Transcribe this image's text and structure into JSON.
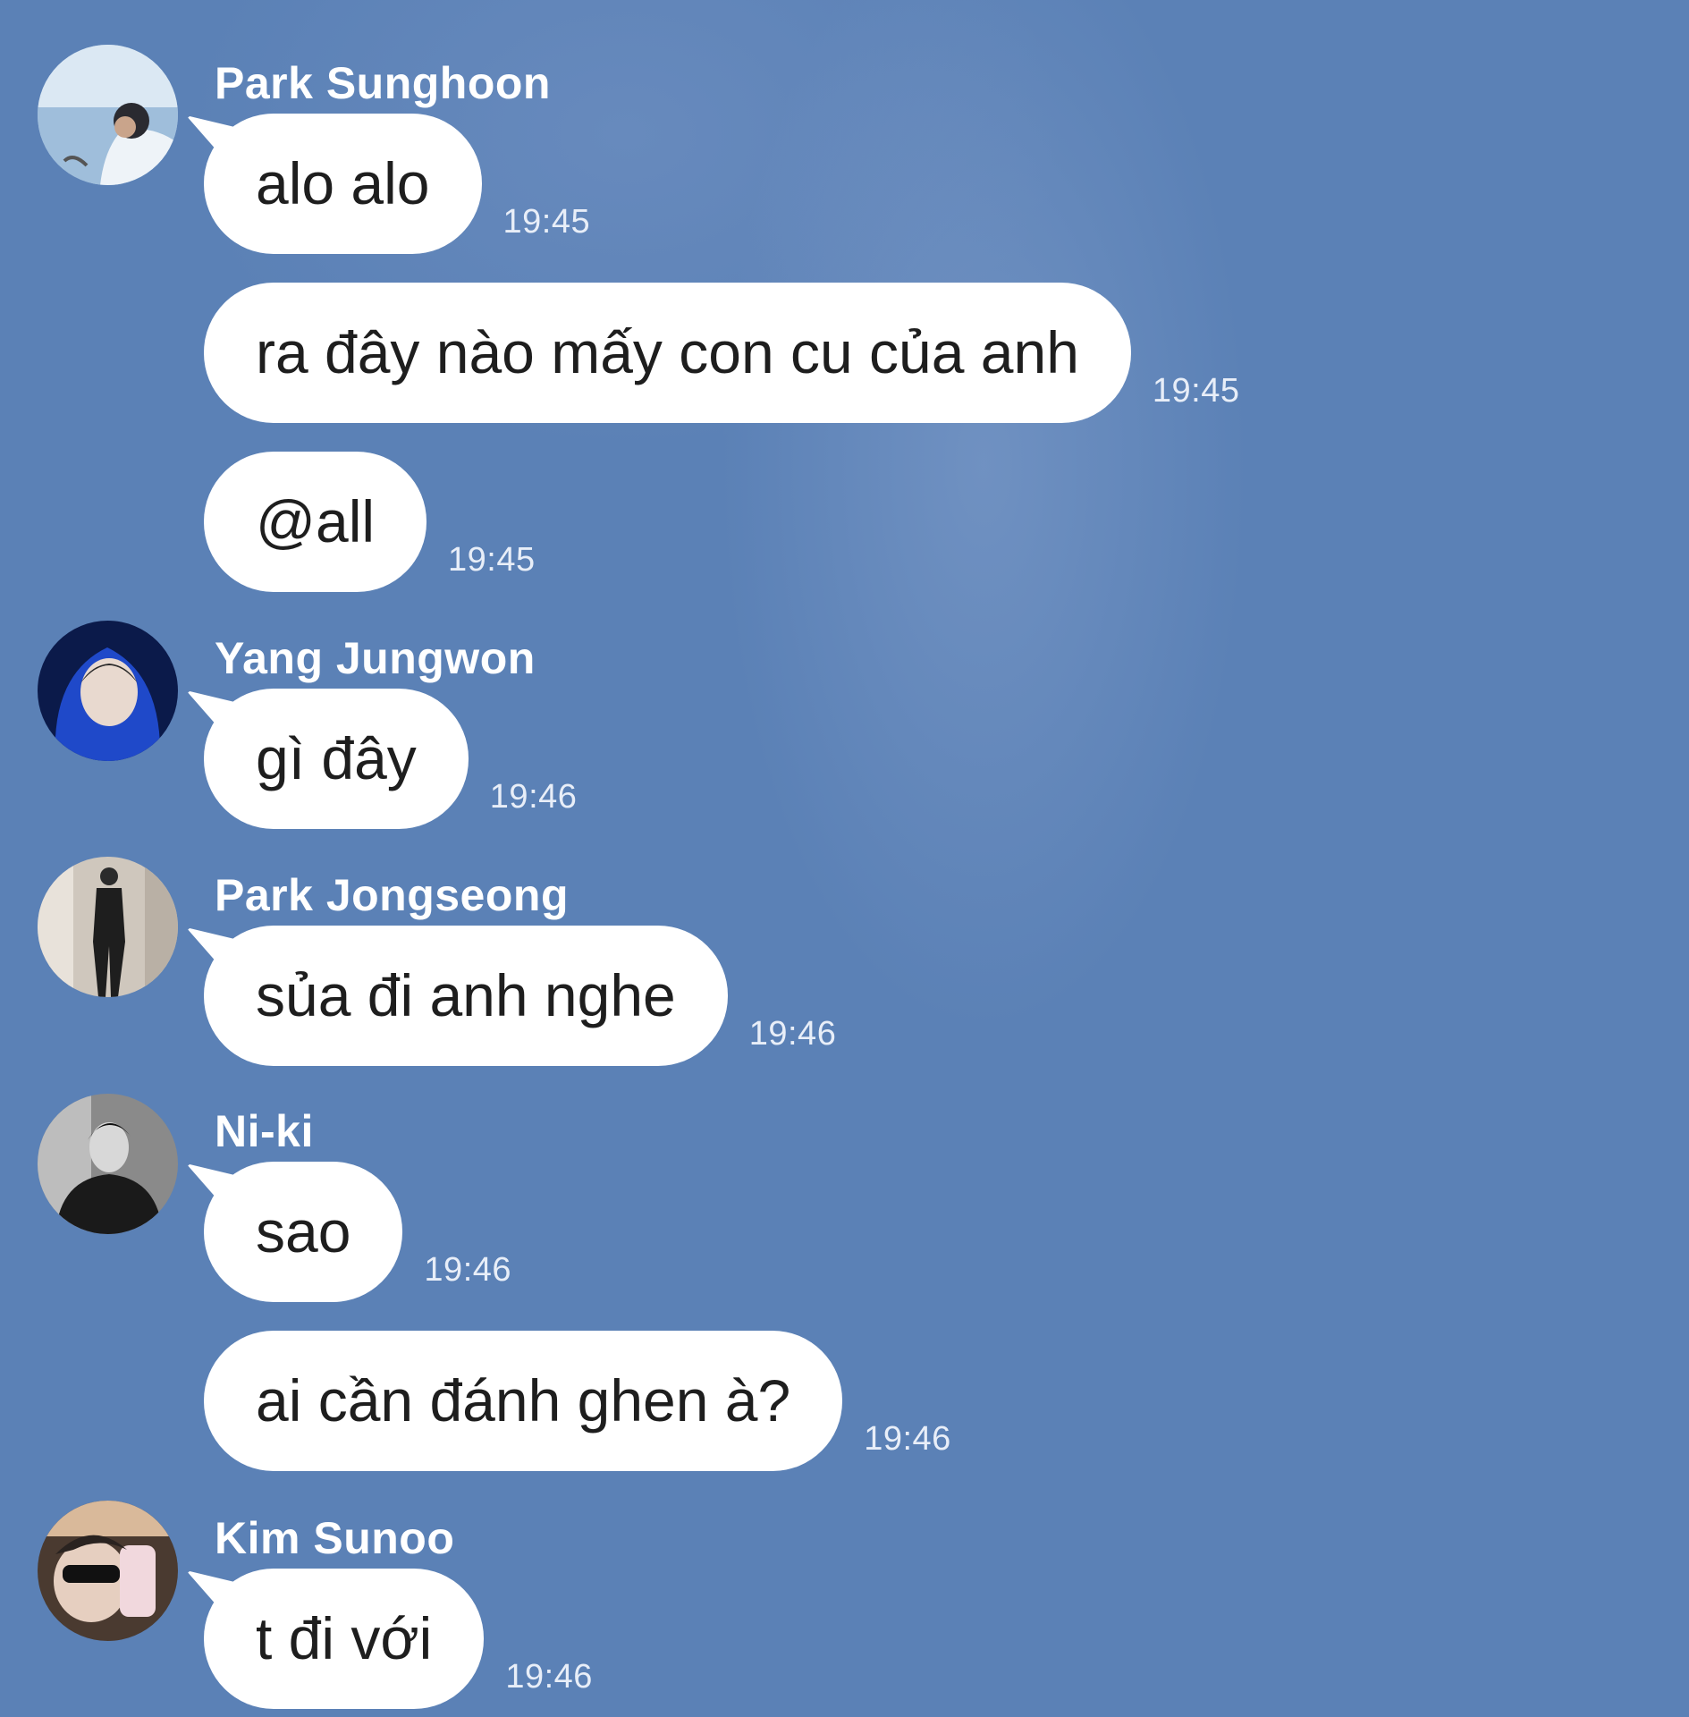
{
  "chat": {
    "groups": [
      {
        "sender": "Park Sunghoon",
        "avatar": "profile-photo-sea",
        "messages": [
          {
            "text": "alo alo",
            "time": "19:45"
          },
          {
            "text": "ra đây nào mấy con cu của anh",
            "time": "19:45"
          },
          {
            "text": "@all",
            "time": "19:45"
          }
        ]
      },
      {
        "sender": "Yang Jungwon",
        "avatar": "profile-photo-blue-hoodie",
        "messages": [
          {
            "text": "gì đây",
            "time": "19:46"
          }
        ]
      },
      {
        "sender": "Park Jongseong",
        "avatar": "profile-photo-standing-figure",
        "messages": [
          {
            "text": "sủa đi anh nghe",
            "time": "19:46"
          }
        ]
      },
      {
        "sender": "Ni-ki",
        "avatar": "profile-photo-black-white",
        "messages": [
          {
            "text": "sao",
            "time": "19:46"
          },
          {
            "text": "ai cần đánh ghen à?",
            "time": "19:46"
          }
        ]
      },
      {
        "sender": "Kim Sunoo",
        "avatar": "profile-photo-sunglasses",
        "messages": [
          {
            "text": "t đi với",
            "time": "19:46"
          }
        ]
      }
    ]
  },
  "colors": {
    "background": "#5b81b6",
    "bubble": "#ffffff",
    "bubble_text": "#1e1e1e",
    "sender_name": "#ffffff",
    "timestamp": "#e8eef8"
  }
}
